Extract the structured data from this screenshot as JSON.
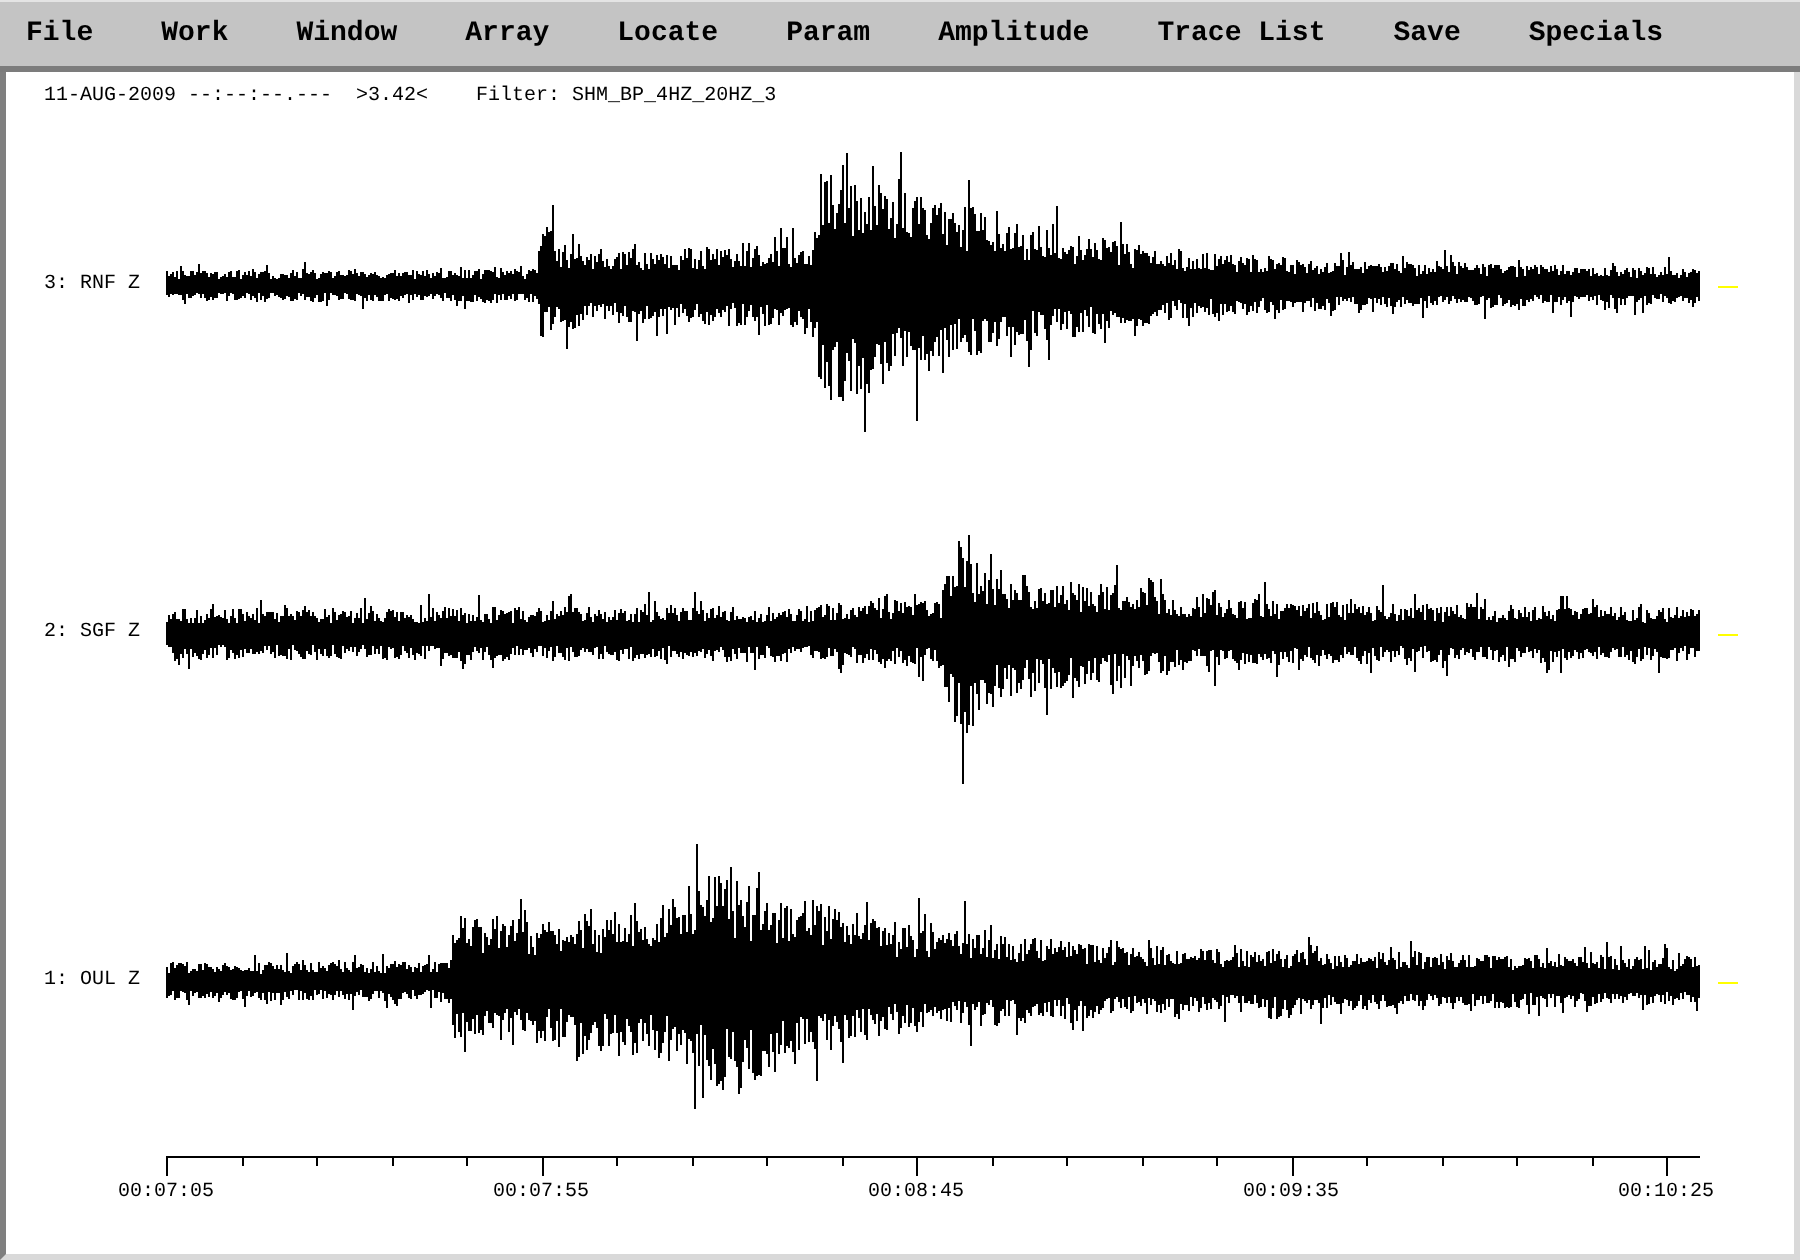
{
  "menu": [
    "File",
    "Work",
    "Window",
    "Array",
    "Locate",
    "Param",
    "Amplitude",
    "Trace List",
    "Save",
    "Specials"
  ],
  "header": {
    "time": "11-AUG-2009 --:--:--.---",
    "scale": ">3.42<",
    "filter": "Filter: SHM_BP_4HZ_20HZ_3"
  },
  "traces": [
    {
      "label": "3: RNF Z"
    },
    {
      "label": "2: SGF Z"
    },
    {
      "label": "1: OUL Z"
    }
  ],
  "time_axis": {
    "labels": [
      "00:07:05",
      "00:07:55",
      "00:08:45",
      "00:09:35",
      "00:10:25"
    ]
  }
}
